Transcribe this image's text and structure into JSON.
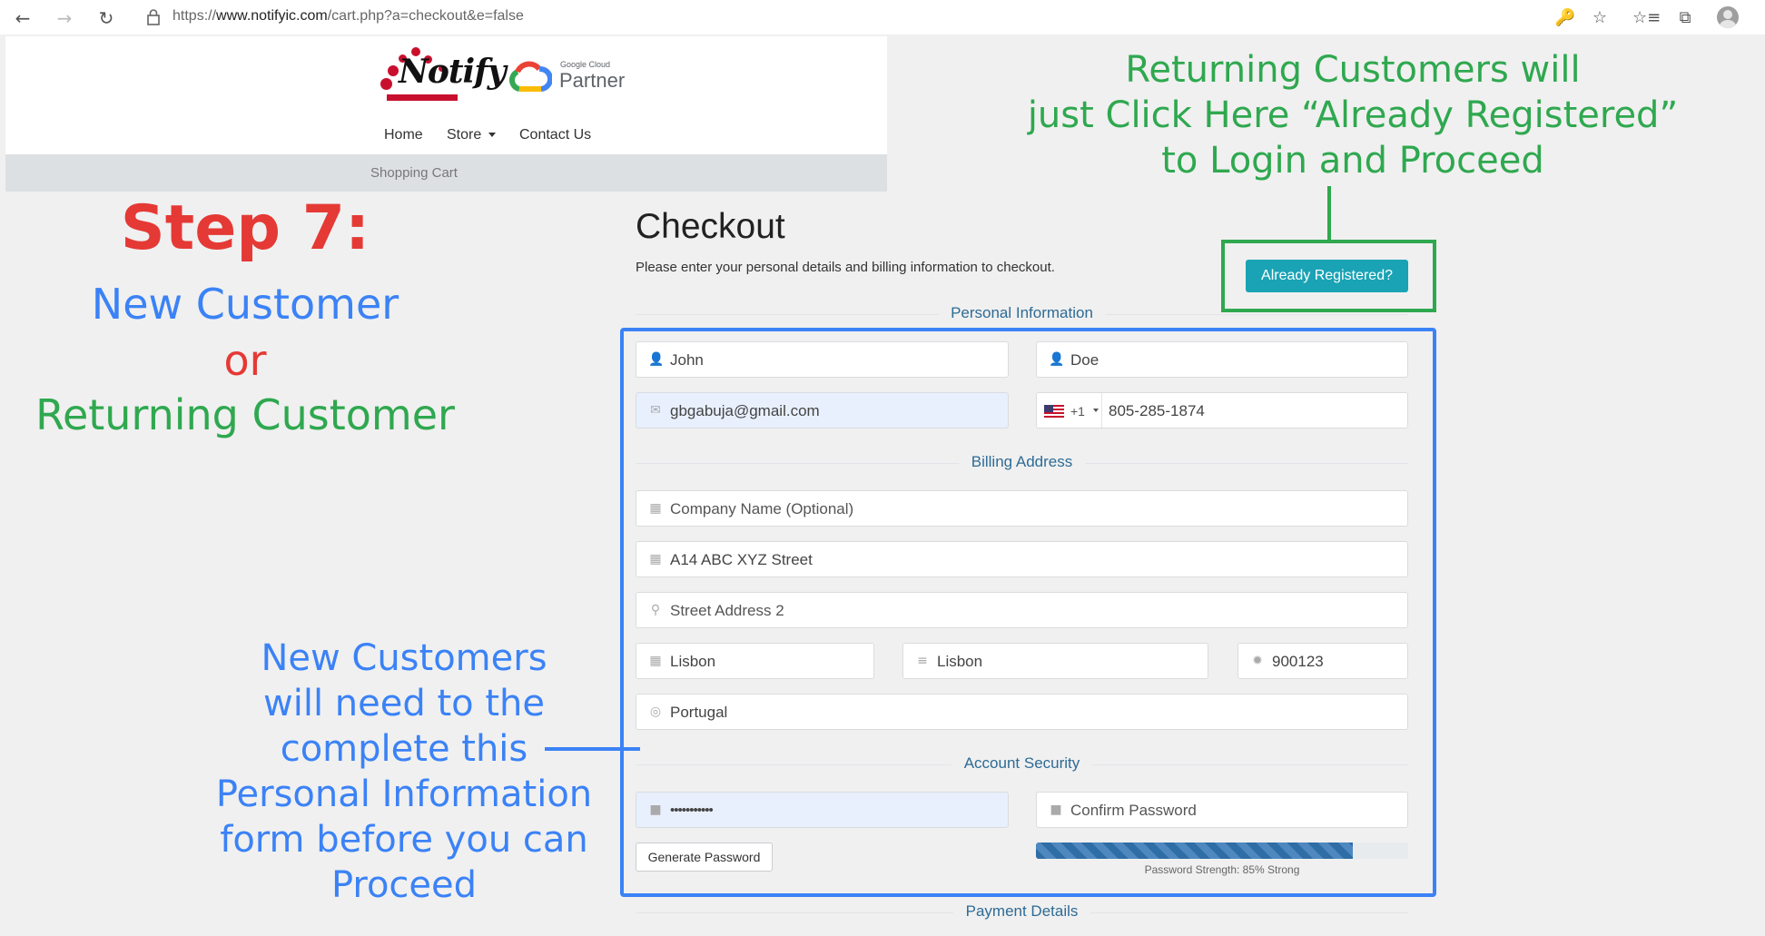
{
  "browser": {
    "url_prefix": "https://",
    "url_domain": "www.notifyic.com",
    "url_path": "/cart.php?a=checkout&e=false"
  },
  "header": {
    "logo_text": "Notify",
    "google_cloud_small": "Google Cloud",
    "partner_text": "Partner",
    "nav": {
      "home": "Home",
      "store": "Store",
      "contact": "Contact Us"
    },
    "breadcrumb": "Shopping Cart"
  },
  "annotations": {
    "step": "Step 7:",
    "new_customer": "New Customer",
    "or": "or",
    "returning_customer": "Returning Customer",
    "returning_lines": [
      "Returning Customers will",
      "just Click Here “Already Registered”",
      "to Login and Proceed"
    ],
    "new_lines": [
      "New Customers",
      "will need to the",
      "complete this",
      "Personal Information",
      "form before you can",
      "Proceed"
    ]
  },
  "checkout": {
    "title": "Checkout",
    "subtitle": "Please enter your personal details and billing information to checkout.",
    "already_registered": "Already Registered?",
    "sections": {
      "personal": "Personal Information",
      "billing": "Billing Address",
      "security": "Account Security",
      "payment": "Payment Details"
    },
    "fields": {
      "first_name": "John",
      "last_name": "Doe",
      "email": "gbgabuja@gmail.com",
      "phone_code": "+1",
      "phone": "805-285-1874",
      "company": "Company Name (Optional)",
      "address1": "A14 ABC XYZ Street",
      "address2": "Street Address 2",
      "city": "Lisbon",
      "state": "Lisbon",
      "postcode": "900123",
      "country": "Portugal",
      "password": "•••••••••••",
      "confirm_password": "Confirm Password"
    },
    "generate_password": "Generate Password",
    "password_strength_text": "Password Strength: 85% Strong",
    "password_strength": 0.85
  }
}
